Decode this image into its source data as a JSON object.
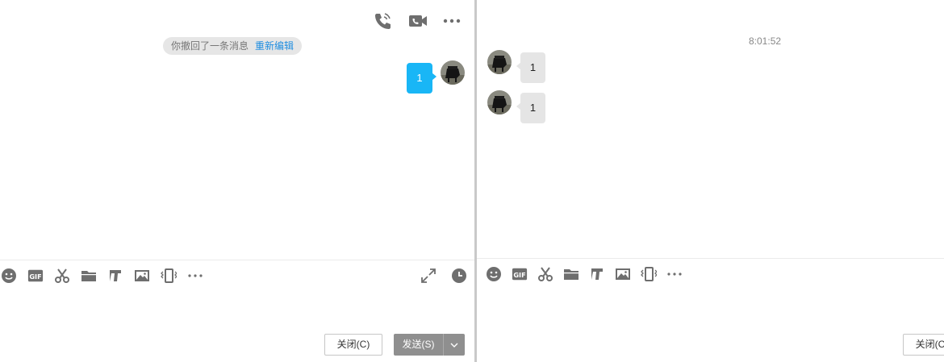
{
  "left_pane": {
    "header_icons": [
      "phone-icon",
      "video-call-icon",
      "more-icon"
    ],
    "recall_notice": {
      "text": "你撤回了一条消息",
      "link": "重新编辑"
    },
    "outgoing_message": "1",
    "toolbar_icons": [
      "emoji-icon",
      "gif-icon",
      "scissors-icon",
      "folder-icon",
      "doc-icon",
      "image-icon",
      "shake-icon",
      "more-dots-icon",
      "expand-icon",
      "clock-icon"
    ],
    "gif_label": "GIF",
    "close_button": "关闭(C)",
    "send_button": "发送(S)"
  },
  "right_pane": {
    "timestamp": "8:01:52",
    "messages": [
      "1",
      "1"
    ],
    "toolbar_icons": [
      "emoji-icon",
      "gif-icon",
      "scissors-icon",
      "folder-icon",
      "doc-icon",
      "image-icon",
      "shake-icon",
      "more-dots-icon"
    ],
    "gif_label": "GIF",
    "close_button": "关闭(C)"
  },
  "colors": {
    "accent_blue": "#19b6f6",
    "link_blue": "#1e8de0",
    "icon_gray": "#6e6e6e",
    "send_gray": "#8f8f8f",
    "incoming_bubble": "#e5e5e5"
  }
}
